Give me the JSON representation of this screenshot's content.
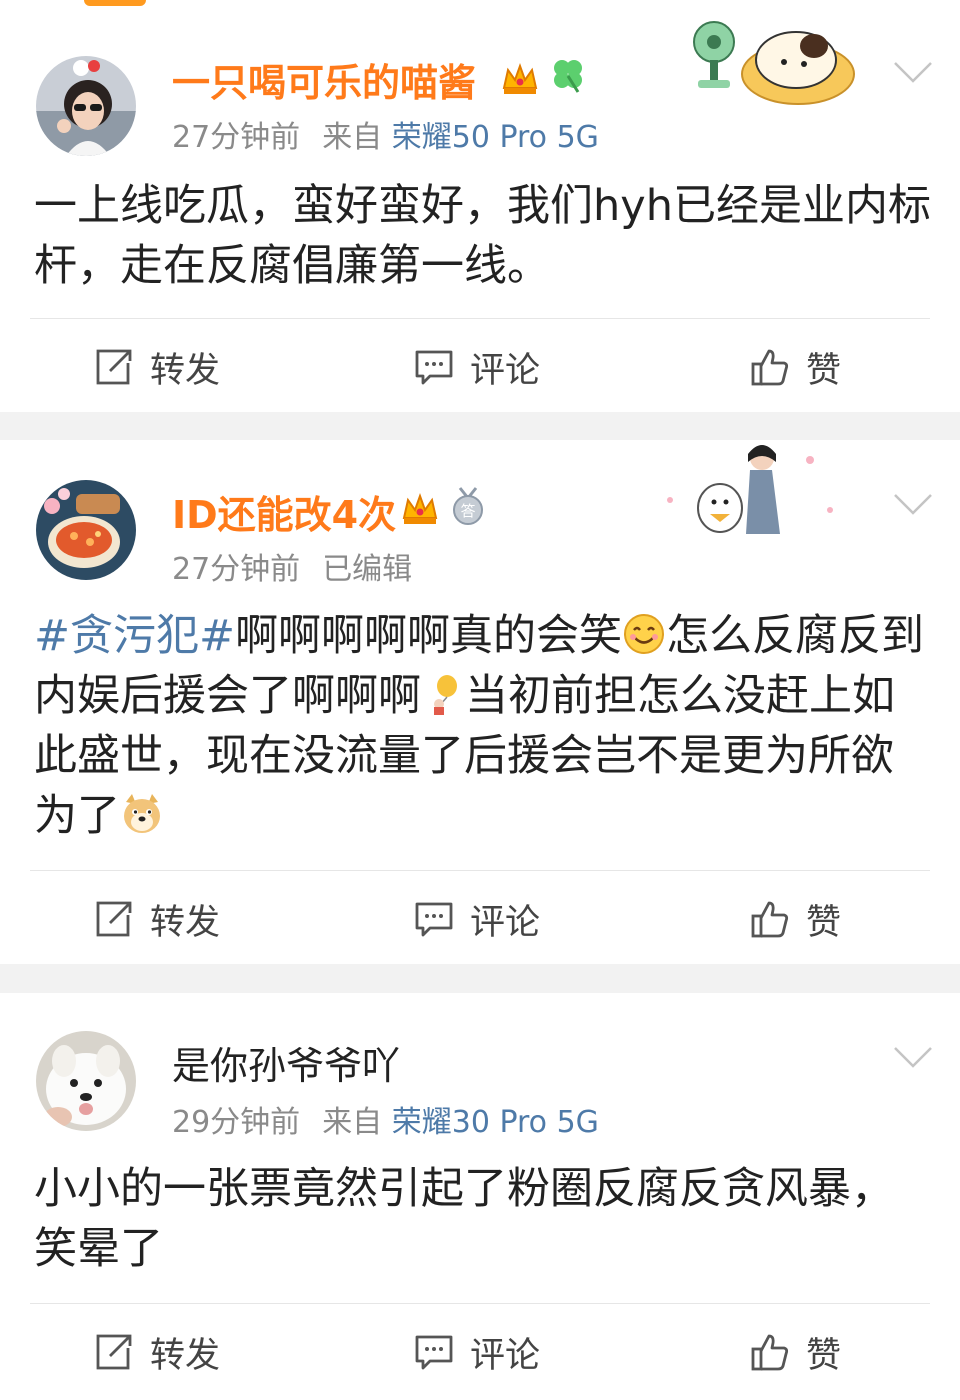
{
  "posts": [
    {
      "username": "一只喝可乐的喵酱",
      "time": "27分钟前",
      "source_prefix": "来自",
      "device": "荣耀50 Pro 5G",
      "content_segments": [
        {
          "type": "text",
          "text": "一上线吃瓜，蛮好蛮好，我们hyh已经是业内标杆，走在反腐倡廉第一线。"
        }
      ],
      "actions": {
        "repost": "转发",
        "comment": "评论",
        "like": "赞"
      }
    },
    {
      "username": "ID还能改4次",
      "time": "27分钟前",
      "edited": "已编辑",
      "content_segments": [
        {
          "type": "topic",
          "text": "#贪污犯#"
        },
        {
          "type": "text",
          "text": "啊啊啊啊啊真的会笑"
        },
        {
          "type": "emoji",
          "icon": "smile-emoji"
        },
        {
          "type": "text",
          "text": "怎么反腐反到内娱后援会了啊啊啊"
        },
        {
          "type": "emoji",
          "icon": "balloon-emoji"
        },
        {
          "type": "text",
          "text": "当初前担怎么没赶上如此盛世，现在没流量了后援会岂不是更为所欲为了"
        },
        {
          "type": "emoji",
          "icon": "doge-emoji"
        }
      ],
      "actions": {
        "repost": "转发",
        "comment": "评论",
        "like": "赞"
      }
    },
    {
      "username": "是你孙爷爷吖",
      "time": "29分钟前",
      "source_prefix": "来自",
      "device": "荣耀30 Pro 5G",
      "content_segments": [
        {
          "type": "text",
          "text": "小小的一张票竟然引起了粉圈反腐反贪风暴，笑晕了"
        }
      ],
      "actions": {
        "repost": "转发",
        "comment": "评论",
        "like": "赞"
      }
    }
  ],
  "colors": {
    "username_vip": "#ff7a1a",
    "link_blue": "#4e7aa8",
    "meta_gray": "#8a8a8a",
    "separator_gray": "#f2f2f2"
  }
}
